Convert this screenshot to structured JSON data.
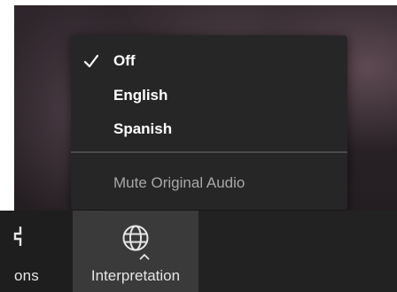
{
  "interpretation_menu": {
    "items": [
      {
        "label": "Off",
        "checked": true
      },
      {
        "label": "English",
        "checked": false
      },
      {
        "label": "Spanish",
        "checked": false
      }
    ],
    "mute_original_audio": "Mute Original Audio"
  },
  "toolbar": {
    "previous_button_label": "ons",
    "interpretation_button_label": "Interpretation",
    "interpretation_icon": "globe-icon",
    "caret_icon": "caret-up-icon"
  },
  "colors": {
    "menu_bg": "#262626",
    "toolbar_bg": "#222222",
    "active_button_bg": "#3a3a3a",
    "text_primary": "#ffffff",
    "text_secondary": "#a8a8a8"
  }
}
